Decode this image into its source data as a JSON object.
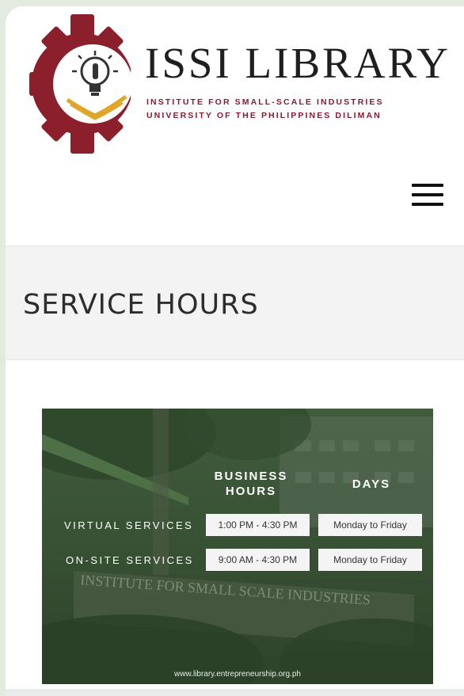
{
  "header": {
    "brand_title": "ISSI LIBRARY",
    "brand_line1": "INSTITUTE FOR SMALL-SCALE INDUSTRIES",
    "brand_line2": "UNIVERSITY OF THE PHILIPPINES DILIMAN",
    "logo_icon": "gear-lightbulb-book-logo",
    "menu_icon": "hamburger-menu-icon"
  },
  "page": {
    "title": "SERVICE HOURS"
  },
  "banner": {
    "col_hours_line1": "BUSINESS",
    "col_hours_line2": "HOURS",
    "col_days": "DAYS",
    "rows": [
      {
        "service": "VIRTUAL SERVICES",
        "hours": "1:00 PM - 4:30 PM",
        "days": "Monday to Friday"
      },
      {
        "service": "ON-SITE SERVICES",
        "hours": "9:00 AM - 4:30 PM",
        "days": "Monday to Friday"
      }
    ],
    "sign_text": "INSTITUTE FOR SMALL SCALE INDUSTRIES",
    "url": "www.library.entrepreneurship.org.ph"
  },
  "colors": {
    "brand_red": "#8b1a2e",
    "banner_green": "#3f5a3b"
  }
}
